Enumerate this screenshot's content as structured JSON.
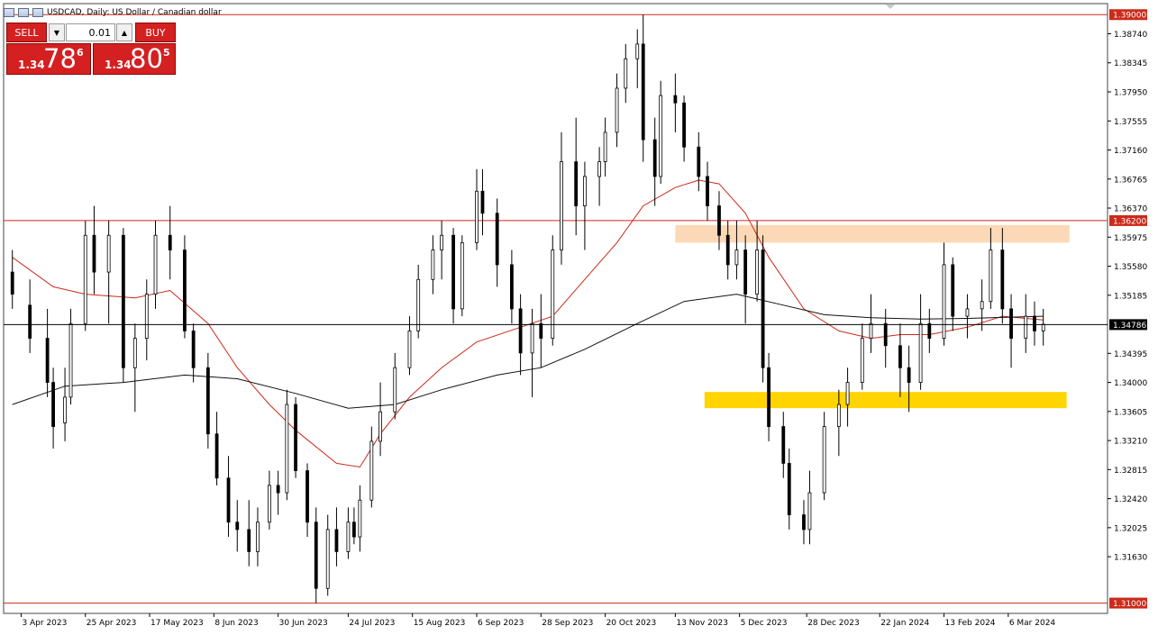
{
  "header": {
    "title": "USDCAD, Daily:  US Dollar / Canadian dollar"
  },
  "trade_panel": {
    "sell_label": "SELL",
    "buy_label": "BUY",
    "lot_value": "0.01",
    "sell_price": {
      "small": "1.34",
      "big": "78",
      "sup": "6"
    },
    "buy_price": {
      "small": "1.34",
      "big": "80",
      "sup": "5"
    }
  },
  "colors": {
    "background": "#ffffff",
    "candle": "#000000",
    "ma_fast": "#cc2a1a",
    "ma_slow": "#111111",
    "resistance_line": "#cc2a1a",
    "resistance_zone": "#fcd9b6",
    "support_zone": "#ffd400",
    "current_price_line": "#000000"
  },
  "chart_data": {
    "type": "candlestick",
    "symbol": "USDCAD",
    "timeframe": "Daily",
    "x_tick_labels": [
      "3 Apr 2023",
      "25 Apr 2023",
      "17 May 2023",
      "8 Jun 2023",
      "30 Jun 2023",
      "24 Jul 2023",
      "15 Aug 2023",
      "6 Sep 2023",
      "28 Sep 2023",
      "20 Oct 2023",
      "13 Nov 2023",
      "5 Dec 2023",
      "28 Dec 2023",
      "22 Jan 2024",
      "13 Feb 2024",
      "6 Mar 2024"
    ],
    "y_tick_labels": [
      "1.38740",
      "1.38345",
      "1.37950",
      "1.37555",
      "1.37160",
      "1.36765",
      "1.36370",
      "1.35975",
      "1.35580",
      "1.35185",
      "1.34395",
      "1.34000",
      "1.33605",
      "1.33210",
      "1.32815",
      "1.32420",
      "1.32025",
      "1.31630"
    ],
    "ylim": [
      1.3086,
      1.3915
    ],
    "horizontal_lines": [
      {
        "price": 1.39,
        "label": "1.39000"
      },
      {
        "price": 1.362,
        "label": "1.36200"
      },
      {
        "price": 1.31,
        "label": "1.31000"
      }
    ],
    "current_price": {
      "price": 1.34786,
      "label": "1.34786"
    },
    "zones": [
      {
        "name": "resistance",
        "from_date": "2023-11-13",
        "to_date": "2024-03-27",
        "price_low": 1.359,
        "price_high": 1.3614
      },
      {
        "name": "support",
        "from_date": "2023-11-23",
        "to_date": "2024-03-26",
        "price_low": 1.3365,
        "price_high": 1.3387
      }
    ],
    "series": [
      {
        "type": "candles",
        "points": [
          [
            "2023-03-31",
            1.355,
            1.358,
            1.35,
            1.352
          ],
          [
            "2023-04-06",
            1.3505,
            1.354,
            1.344,
            1.346
          ],
          [
            "2023-04-12",
            1.346,
            1.35,
            1.338,
            1.34
          ],
          [
            "2023-04-14",
            1.34,
            1.342,
            1.331,
            1.334
          ],
          [
            "2023-04-18",
            1.3345,
            1.342,
            1.332,
            1.338
          ],
          [
            "2023-04-20",
            1.338,
            1.35,
            1.337,
            1.348
          ],
          [
            "2023-04-25",
            1.348,
            1.362,
            1.347,
            1.36
          ],
          [
            "2023-04-28",
            1.36,
            1.364,
            1.352,
            1.355
          ],
          [
            "2023-05-03",
            1.355,
            1.362,
            1.348,
            1.36
          ],
          [
            "2023-05-08",
            1.36,
            1.361,
            1.34,
            1.342
          ],
          [
            "2023-05-12",
            1.342,
            1.348,
            1.336,
            1.346
          ],
          [
            "2023-05-16",
            1.346,
            1.354,
            1.343,
            1.352
          ],
          [
            "2023-05-19",
            1.352,
            1.362,
            1.35,
            1.36
          ],
          [
            "2023-05-24",
            1.36,
            1.364,
            1.354,
            1.358
          ],
          [
            "2023-05-29",
            1.358,
            1.36,
            1.346,
            1.347
          ],
          [
            "2023-06-01",
            1.347,
            1.348,
            1.34,
            1.342
          ],
          [
            "2023-06-06",
            1.342,
            1.344,
            1.331,
            1.333
          ],
          [
            "2023-06-09",
            1.333,
            1.336,
            1.326,
            1.327
          ],
          [
            "2023-06-13",
            1.327,
            1.33,
            1.319,
            1.321
          ],
          [
            "2023-06-16",
            1.321,
            1.324,
            1.317,
            1.32
          ],
          [
            "2023-06-20",
            1.32,
            1.324,
            1.315,
            1.317
          ],
          [
            "2023-06-23",
            1.317,
            1.323,
            1.315,
            1.321
          ],
          [
            "2023-06-27",
            1.321,
            1.328,
            1.32,
            1.326
          ],
          [
            "2023-06-30",
            1.326,
            1.328,
            1.322,
            1.325
          ],
          [
            "2023-07-03",
            1.325,
            1.339,
            1.324,
            1.337
          ],
          [
            "2023-07-06",
            1.337,
            1.338,
            1.327,
            1.328
          ],
          [
            "2023-07-10",
            1.328,
            1.329,
            1.319,
            1.321
          ],
          [
            "2023-07-13",
            1.321,
            1.323,
            1.31,
            1.312
          ],
          [
            "2023-07-17",
            1.312,
            1.322,
            1.311,
            1.32
          ],
          [
            "2023-07-20",
            1.32,
            1.323,
            1.315,
            1.317
          ],
          [
            "2023-07-24",
            1.317,
            1.323,
            1.316,
            1.321
          ],
          [
            "2023-07-26",
            1.321,
            1.323,
            1.318,
            1.319
          ],
          [
            "2023-07-28",
            1.319,
            1.326,
            1.317,
            1.324
          ],
          [
            "2023-08-01",
            1.324,
            1.334,
            1.323,
            1.332
          ],
          [
            "2023-08-04",
            1.332,
            1.34,
            1.33,
            1.336
          ],
          [
            "2023-08-09",
            1.336,
            1.344,
            1.335,
            1.342
          ],
          [
            "2023-08-14",
            1.342,
            1.349,
            1.341,
            1.347
          ],
          [
            "2023-08-17",
            1.347,
            1.356,
            1.346,
            1.354
          ],
          [
            "2023-08-22",
            1.354,
            1.36,
            1.352,
            1.358
          ],
          [
            "2023-08-25",
            1.358,
            1.362,
            1.354,
            1.36
          ],
          [
            "2023-08-29",
            1.36,
            1.361,
            1.348,
            1.35
          ],
          [
            "2023-09-01",
            1.35,
            1.36,
            1.349,
            1.359
          ],
          [
            "2023-09-06",
            1.359,
            1.369,
            1.358,
            1.366
          ],
          [
            "2023-09-08",
            1.366,
            1.369,
            1.36,
            1.363
          ],
          [
            "2023-09-13",
            1.363,
            1.365,
            1.353,
            1.356
          ],
          [
            "2023-09-18",
            1.356,
            1.358,
            1.348,
            1.35
          ],
          [
            "2023-09-21",
            1.35,
            1.352,
            1.341,
            1.344
          ],
          [
            "2023-09-25",
            1.344,
            1.35,
            1.338,
            1.348
          ],
          [
            "2023-09-28",
            1.348,
            1.352,
            1.342,
            1.346
          ],
          [
            "2023-10-02",
            1.346,
            1.36,
            1.345,
            1.358
          ],
          [
            "2023-10-05",
            1.358,
            1.374,
            1.356,
            1.37
          ],
          [
            "2023-10-10",
            1.37,
            1.376,
            1.36,
            1.364
          ],
          [
            "2023-10-13",
            1.364,
            1.37,
            1.358,
            1.368
          ],
          [
            "2023-10-18",
            1.368,
            1.372,
            1.364,
            1.37
          ],
          [
            "2023-10-20",
            1.37,
            1.376,
            1.368,
            1.374
          ],
          [
            "2023-10-24",
            1.374,
            1.382,
            1.372,
            1.38
          ],
          [
            "2023-10-27",
            1.38,
            1.386,
            1.378,
            1.384
          ],
          [
            "2023-10-31",
            1.384,
            1.388,
            1.38,
            1.386
          ],
          [
            "2023-11-02",
            1.386,
            1.39,
            1.37,
            1.373
          ],
          [
            "2023-11-06",
            1.373,
            1.376,
            1.364,
            1.368
          ],
          [
            "2023-11-08",
            1.368,
            1.381,
            1.367,
            1.379
          ],
          [
            "2023-11-13",
            1.379,
            1.382,
            1.374,
            1.378
          ],
          [
            "2023-11-16",
            1.378,
            1.379,
            1.37,
            1.372
          ],
          [
            "2023-11-21",
            1.372,
            1.374,
            1.366,
            1.368
          ],
          [
            "2023-11-24",
            1.368,
            1.37,
            1.362,
            1.364
          ],
          [
            "2023-11-28",
            1.364,
            1.366,
            1.358,
            1.36
          ],
          [
            "2023-12-01",
            1.36,
            1.362,
            1.354,
            1.356
          ],
          [
            "2023-12-04",
            1.356,
            1.362,
            1.354,
            1.358
          ],
          [
            "2023-12-07",
            1.358,
            1.36,
            1.348,
            1.352
          ],
          [
            "2023-12-11",
            1.352,
            1.362,
            1.351,
            1.358
          ],
          [
            "2023-12-13",
            1.358,
            1.36,
            1.34,
            1.342
          ],
          [
            "2023-12-15",
            1.342,
            1.344,
            1.332,
            1.334
          ],
          [
            "2023-12-20",
            1.334,
            1.336,
            1.327,
            1.329
          ],
          [
            "2023-12-22",
            1.329,
            1.331,
            1.32,
            1.322
          ],
          [
            "2023-12-27",
            1.322,
            1.324,
            1.318,
            1.32
          ],
          [
            "2023-12-29",
            1.32,
            1.328,
            1.318,
            1.325
          ],
          [
            "2024-01-03",
            1.325,
            1.336,
            1.324,
            1.334
          ],
          [
            "2024-01-08",
            1.334,
            1.339,
            1.33,
            1.337
          ],
          [
            "2024-01-11",
            1.337,
            1.342,
            1.334,
            1.34
          ],
          [
            "2024-01-16",
            1.34,
            1.348,
            1.339,
            1.346
          ],
          [
            "2024-01-19",
            1.346,
            1.352,
            1.344,
            1.348
          ],
          [
            "2024-01-24",
            1.348,
            1.35,
            1.342,
            1.345
          ],
          [
            "2024-01-29",
            1.345,
            1.348,
            1.338,
            1.342
          ],
          [
            "2024-02-01",
            1.342,
            1.345,
            1.336,
            1.34
          ],
          [
            "2024-02-05",
            1.34,
            1.352,
            1.339,
            1.348
          ],
          [
            "2024-02-08",
            1.348,
            1.35,
            1.344,
            1.346
          ],
          [
            "2024-02-13",
            1.346,
            1.359,
            1.345,
            1.356
          ],
          [
            "2024-02-16",
            1.356,
            1.357,
            1.347,
            1.349
          ],
          [
            "2024-02-21",
            1.349,
            1.352,
            1.346,
            1.35
          ],
          [
            "2024-02-26",
            1.35,
            1.354,
            1.347,
            1.351
          ],
          [
            "2024-02-29",
            1.351,
            1.361,
            1.35,
            1.358
          ],
          [
            "2024-03-04",
            1.358,
            1.361,
            1.348,
            1.35
          ],
          [
            "2024-03-07",
            1.35,
            1.352,
            1.342,
            1.346
          ],
          [
            "2024-03-12",
            1.346,
            1.352,
            1.344,
            1.349
          ],
          [
            "2024-03-15",
            1.349,
            1.351,
            1.345,
            1.347
          ],
          [
            "2024-03-18",
            1.347,
            1.35,
            1.345,
            1.3479
          ]
        ]
      },
      {
        "type": "line",
        "role": "ma_fast",
        "points": [
          [
            "2023-03-31",
            1.357
          ],
          [
            "2023-04-14",
            1.353
          ],
          [
            "2023-04-25",
            1.352
          ],
          [
            "2023-05-12",
            1.3515
          ],
          [
            "2023-05-24",
            1.3525
          ],
          [
            "2023-06-06",
            1.348
          ],
          [
            "2023-06-16",
            1.342
          ],
          [
            "2023-06-27",
            1.337
          ],
          [
            "2023-07-06",
            1.3335
          ],
          [
            "2023-07-20",
            1.329
          ],
          [
            "2023-07-28",
            1.3285
          ],
          [
            "2023-08-04",
            1.333
          ],
          [
            "2023-08-14",
            1.338
          ],
          [
            "2023-08-25",
            1.342
          ],
          [
            "2023-09-06",
            1.3455
          ],
          [
            "2023-09-21",
            1.3475
          ],
          [
            "2023-10-02",
            1.349
          ],
          [
            "2023-10-13",
            1.354
          ],
          [
            "2023-10-24",
            1.359
          ],
          [
            "2023-11-02",
            1.364
          ],
          [
            "2023-11-13",
            1.3665
          ],
          [
            "2023-11-21",
            1.3675
          ],
          [
            "2023-11-28",
            1.367
          ],
          [
            "2023-12-07",
            1.363
          ],
          [
            "2023-12-15",
            1.357
          ],
          [
            "2023-12-27",
            1.35
          ],
          [
            "2024-01-08",
            1.347
          ],
          [
            "2024-01-19",
            1.346
          ],
          [
            "2024-01-29",
            1.3465
          ],
          [
            "2024-02-08",
            1.3465
          ],
          [
            "2024-02-21",
            1.3475
          ],
          [
            "2024-03-04",
            1.349
          ],
          [
            "2024-03-18",
            1.3485
          ]
        ]
      },
      {
        "type": "line",
        "role": "ma_slow",
        "points": [
          [
            "2023-03-31",
            1.337
          ],
          [
            "2023-04-18",
            1.3395
          ],
          [
            "2023-05-08",
            1.34
          ],
          [
            "2023-05-29",
            1.341
          ],
          [
            "2023-06-16",
            1.3405
          ],
          [
            "2023-07-06",
            1.3385
          ],
          [
            "2023-07-24",
            1.3365
          ],
          [
            "2023-08-09",
            1.337
          ],
          [
            "2023-08-25",
            1.339
          ],
          [
            "2023-09-13",
            1.341
          ],
          [
            "2023-09-28",
            1.342
          ],
          [
            "2023-10-13",
            1.3445
          ],
          [
            "2023-10-31",
            1.348
          ],
          [
            "2023-11-16",
            1.351
          ],
          [
            "2023-12-04",
            1.352
          ],
          [
            "2023-12-20",
            1.3505
          ],
          [
            "2024-01-03",
            1.3492
          ],
          [
            "2024-01-19",
            1.3488
          ],
          [
            "2024-02-05",
            1.3486
          ],
          [
            "2024-02-21",
            1.3487
          ],
          [
            "2024-03-18",
            1.349
          ]
        ]
      }
    ]
  }
}
